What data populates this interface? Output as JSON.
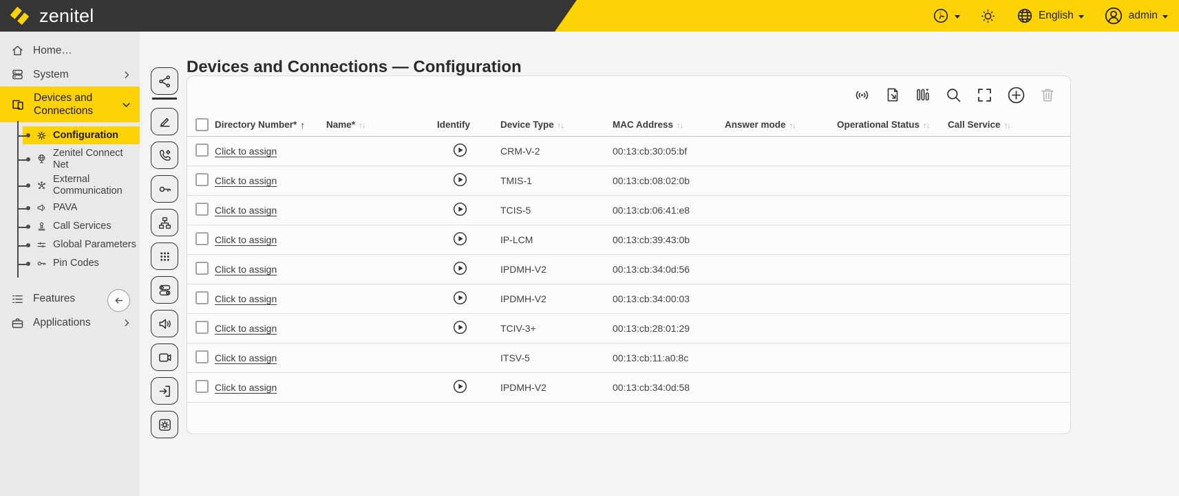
{
  "topbar": {
    "logo_text": "zenitel",
    "icons": [
      "clock-icon",
      "brightness-icon",
      "globe-icon",
      "user-icon"
    ],
    "language": {
      "label": "English"
    },
    "user": {
      "label": "admin"
    }
  },
  "sidebar": {
    "home": {
      "label": "Home…",
      "icon": "home-icon"
    },
    "system": {
      "label": "System",
      "icon": "server-stack-icon"
    },
    "devices_and_connections": {
      "label": "Devices and Connections",
      "icon": "devices-icon"
    },
    "submenu": [
      {
        "label": "Configuration",
        "icon": "gear-icon",
        "active": true
      },
      {
        "label": "Zenitel Connect Net",
        "icon": "globe-stand-icon"
      },
      {
        "label": "External Communication",
        "icon": "node-network-icon"
      },
      {
        "label": "PAVA",
        "icon": "megaphone-icon"
      },
      {
        "label": "Call Services",
        "icon": "stamp-icon"
      },
      {
        "label": "Global Parameters",
        "icon": "sliders-icon"
      },
      {
        "label": "Pin Codes",
        "icon": "key-icon"
      }
    ],
    "features": {
      "label": "Features",
      "icon": "list-icon"
    },
    "applications": {
      "label": "Applications",
      "icon": "briefcase-icon"
    },
    "back_button_icon": "arrow-left-icon"
  },
  "tool_rail": {
    "buttons": [
      {
        "icon": "topology-icon",
        "active": true
      },
      {
        "icon": "pencil-icon"
      },
      {
        "icon": "phone-gear-icon"
      },
      {
        "icon": "key-icon"
      },
      {
        "icon": "sitemap-icon"
      },
      {
        "icon": "keypad-icon"
      },
      {
        "icon": "toggles-icon"
      },
      {
        "icon": "speaker-icon"
      },
      {
        "icon": "camera-icon"
      },
      {
        "icon": "door-exit-icon"
      },
      {
        "icon": "gear-frame-icon"
      }
    ]
  },
  "page": {
    "title": "Devices and Connections — Configuration"
  },
  "table": {
    "toolbar_icons": [
      "broadcast-icon",
      "file-export-icon",
      "filter-columns-icon",
      "search-icon",
      "fullscreen-icon",
      "add-icon",
      "delete-icon"
    ],
    "columns": [
      {
        "label": "",
        "type": "select-all-checkbox"
      },
      {
        "label": "Directory Number*",
        "sort": "asc"
      },
      {
        "label": "Name*",
        "sort": "none"
      },
      {
        "label": "Identify",
        "sort": null
      },
      {
        "label": "Device Type",
        "sort": "none"
      },
      {
        "label": "MAC Address",
        "sort": "none"
      },
      {
        "label": "Answer mode",
        "sort": "none"
      },
      {
        "label": "Operational Status",
        "sort": "none"
      },
      {
        "label": "Call Service",
        "sort": "none"
      }
    ],
    "rows": [
      {
        "directory_number": "Click to assign",
        "name": "",
        "identify": true,
        "device_type": "CRM-V-2",
        "mac_address": "00:13:cb:30:05:bf",
        "answer_mode": "",
        "operational_status": "",
        "call_service": ""
      },
      {
        "directory_number": "Click to assign",
        "name": "",
        "identify": true,
        "device_type": "TMIS-1",
        "mac_address": "00:13:cb:08:02:0b",
        "answer_mode": "",
        "operational_status": "",
        "call_service": ""
      },
      {
        "directory_number": "Click to assign",
        "name": "",
        "identify": true,
        "device_type": "TCIS-5",
        "mac_address": "00:13:cb:06:41:e8",
        "answer_mode": "",
        "operational_status": "",
        "call_service": ""
      },
      {
        "directory_number": "Click to assign",
        "name": "",
        "identify": true,
        "device_type": "IP-LCM",
        "mac_address": "00:13:cb:39:43:0b",
        "answer_mode": "",
        "operational_status": "",
        "call_service": ""
      },
      {
        "directory_number": "Click to assign",
        "name": "",
        "identify": true,
        "device_type": "IPDMH-V2",
        "mac_address": "00:13:cb:34:0d:56",
        "answer_mode": "",
        "operational_status": "",
        "call_service": ""
      },
      {
        "directory_number": "Click to assign",
        "name": "",
        "identify": true,
        "device_type": "IPDMH-V2",
        "mac_address": "00:13:cb:34:00:03",
        "answer_mode": "",
        "operational_status": "",
        "call_service": ""
      },
      {
        "directory_number": "Click to assign",
        "name": "",
        "identify": true,
        "device_type": "TCIV-3+",
        "mac_address": "00:13:cb:28:01:29",
        "answer_mode": "",
        "operational_status": "",
        "call_service": ""
      },
      {
        "directory_number": "Click to assign",
        "name": "",
        "identify": false,
        "device_type": "ITSV-5",
        "mac_address": "00:13:cb:11:a0:8c",
        "answer_mode": "",
        "operational_status": "",
        "call_service": ""
      },
      {
        "directory_number": "Click to assign",
        "name": "",
        "identify": true,
        "device_type": "IPDMH-V2",
        "mac_address": "00:13:cb:34:0d:58",
        "answer_mode": "",
        "operational_status": "",
        "call_service": ""
      }
    ]
  },
  "colors": {
    "brand_yellow": "#fdd306",
    "topbar_dark": "#363636",
    "clock_hand_orange": "#e0662a"
  }
}
